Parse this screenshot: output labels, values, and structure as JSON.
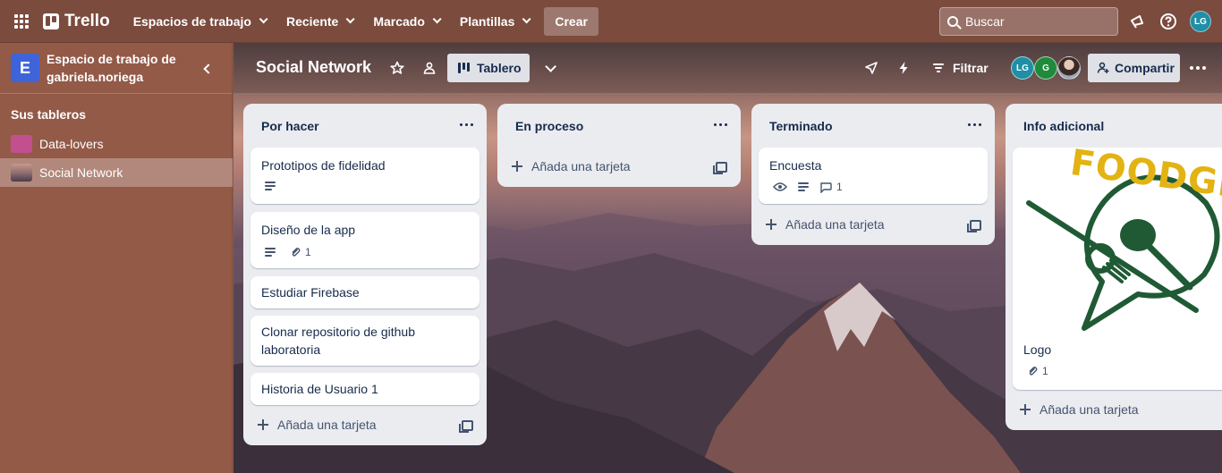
{
  "topbar": {
    "app_name": "Trello",
    "nav": [
      "Espacios de trabajo",
      "Reciente",
      "Marcado",
      "Plantillas"
    ],
    "create_label": "Crear",
    "search_placeholder": "Buscar",
    "user_initials": "LG"
  },
  "sidebar": {
    "workspace_initial": "E",
    "workspace_name": "Espacio de trabajo de gabriela.noriega",
    "boards_title": "Sus tableros",
    "boards": [
      {
        "name": "Data-lovers",
        "color": "#c2508f"
      },
      {
        "name": "Social Network",
        "active": true
      }
    ]
  },
  "board": {
    "title": "Social Network",
    "view_label": "Tablero",
    "filter_label": "Filtrar",
    "share_label": "Compartir",
    "members": [
      {
        "initials": "LG",
        "color": "#1f8ea6"
      },
      {
        "initials": "G",
        "color": "#1f8a3b"
      },
      {
        "initials": "",
        "color": "#8f6b5c"
      }
    ],
    "lists": [
      {
        "title": "Por hacer",
        "cards": [
          {
            "title": "Prototipos de fidelidad",
            "badges": {
              "description": true
            }
          },
          {
            "title": "Diseño de la app",
            "badges": {
              "description": true,
              "attachments": "1"
            }
          },
          {
            "title": "Estudiar Firebase"
          },
          {
            "title": "Clonar repositorio de github laboratoria"
          },
          {
            "title": "Historia de Usuario 1"
          }
        ],
        "add_label": "Añada una tarjeta"
      },
      {
        "title": "En proceso",
        "cards": [],
        "add_label": "Añada una tarjeta"
      },
      {
        "title": "Terminado",
        "cards": [
          {
            "title": "Encuesta",
            "badges": {
              "watching": true,
              "description": true,
              "comments": "1"
            }
          }
        ],
        "add_label": "Añada una tarjeta"
      },
      {
        "title": "Info adicional",
        "cards": [
          {
            "title": "Logo",
            "cover_text": "FOODGRAM",
            "badges": {
              "attachments": "1"
            }
          }
        ],
        "add_label": "Añada una tarjeta"
      }
    ]
  }
}
